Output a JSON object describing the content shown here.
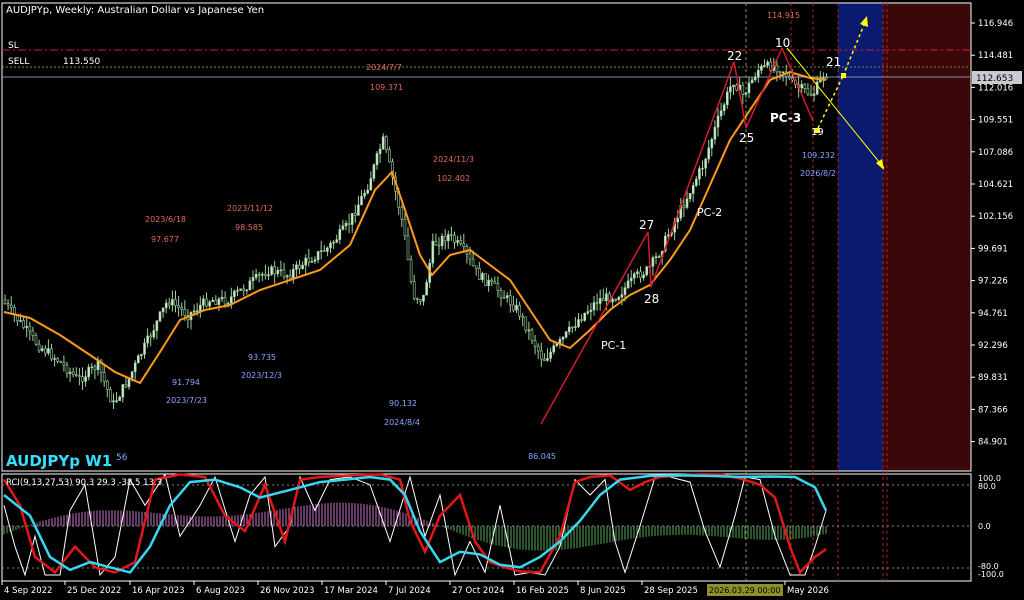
{
  "header": {
    "title": "AUDJPYp, Weekly:  Australian Dollar vs Japanese Yen",
    "sl_label": "SL",
    "sell_label": "SELL",
    "sell_price": "113.550"
  },
  "big_label": "AUDJPYp W1",
  "current_price": "112.653",
  "y_ticks": [
    "116.946",
    "114.481",
    "112.016",
    "109.551",
    "107.086",
    "104.621",
    "102.156",
    "99.691",
    "97.226",
    "94.761",
    "92.296",
    "89.831",
    "87.366",
    "84.901"
  ],
  "x_ticks": [
    "4 Sep 2022",
    "25 Dec 2022",
    "16 Apr 2023",
    "6 Aug 2023",
    "26 Nov 2023",
    "17 Mar 2024",
    "7 Jul 2024",
    "27 Oct 2024",
    "16 Feb 2025",
    "8 Jun 2025",
    "28 Sep 2025",
    "May 2026"
  ],
  "cursor_time": "2026.03.29 00:00",
  "annotations_high": [
    {
      "date": "2023/6/18",
      "price": "97.677"
    },
    {
      "date": "2023/11/12",
      "price": "98.585"
    },
    {
      "date": "2024/7/7",
      "price": "109.371"
    },
    {
      "date": "2024/11/3",
      "price": "102.402"
    },
    {
      "price": "114.915"
    }
  ],
  "annotations_low": [
    {
      "price": "91.794",
      "date": "2023/7/23"
    },
    {
      "price": "93.735",
      "date": "2023/12/3"
    },
    {
      "price": "90.132",
      "date": "2024/8/4"
    },
    {
      "price": "86.045"
    },
    {
      "price": "109.232",
      "date": "2026/8/2"
    }
  ],
  "bottom_left_partial": "56",
  "wave_labels": [
    "27",
    "28",
    "22",
    "25",
    "10",
    "21",
    "19"
  ],
  "pc_labels": [
    "PC-1",
    "PC-2",
    "PC-3"
  ],
  "indicator": {
    "title": "RCI(9,13,27,53) 90.3 29.3 -38.5 13.3",
    "levels": [
      "100.0",
      "80.0",
      "0.0",
      "-80.0",
      "-100.0"
    ]
  },
  "colors": {
    "background": "#000000",
    "candle": "#9ccf9c",
    "ma": "#ff9a1a",
    "trend": "#d61a2a",
    "future_zone": "#0a1a6e",
    "danger_zone": "#3a0808",
    "high_text": "#e06a5a",
    "low_text": "#8aa6ff",
    "label_cyan": "#35e0ff",
    "projection": "#ffff00"
  },
  "chart_data": {
    "type": "line",
    "title": "AUDJPYp, Weekly:  Australian Dollar vs Japanese Yen",
    "ylim": [
      83.7,
      118.0
    ],
    "series": [
      {
        "name": "AUDJPYp",
        "x": [
          "4 Sep 2022",
          "25 Dec 2022",
          "16 Apr 2023",
          "6 Aug 2023",
          "26 Nov 2023",
          "17 Mar 2024",
          "7 Jul 2024",
          "27 Oct 2024",
          "16 Feb 2025",
          "8 Jun 2025",
          "28 Sep 2025",
          "May 2026"
        ],
        "values": [
          95.2,
          91.0,
          89.8,
          94.0,
          96.6,
          98.8,
          107.5,
          100.2,
          93.0,
          94.8,
          104.0,
          112.6
        ]
      }
    ]
  }
}
